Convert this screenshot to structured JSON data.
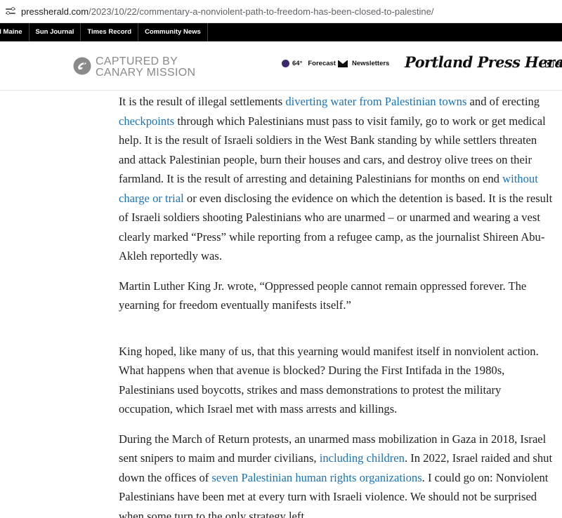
{
  "browser": {
    "url_host": "pressherald.com",
    "url_path": "/2023/10/22/commentary-a-nonviolent-path-to-freedom-has-been-closed-to-palestine/"
  },
  "topnav": {
    "items": [
      "al Maine",
      "Sun Journal",
      "Times Record",
      "Community News"
    ]
  },
  "header": {
    "canary_line1": "CAPTURED BY",
    "canary_line2": "CANARY MISSION",
    "temperature": "64°",
    "forecast_label": "Forecast",
    "newsletters_label": "Newsletters",
    "masthead": "Portland Press Herald",
    "epaper_label": "e",
    "colors": {
      "canary_gray": "#8a8a8a",
      "link_blue": "#1a73b8",
      "moon_purple": "#3b2a6e"
    }
  },
  "article": {
    "p1": {
      "t1": "It is the result of illegal settlements ",
      "l1": "diverting water from Palestinian towns",
      "t2": " and of erecting ",
      "l2": "checkpoints",
      "t3": " through which Palestinians must pass to visit family, go to work or get medical help. It is the result of Israeli soldiers in the West Bank standing by while settlers threaten and attack Palestinian people, burn their houses and cars, and destroy olive trees on their farmland. It is the result of arresting and detaining Palestinians for months on end ",
      "l3": "without charge or trial",
      "t4": " or even disclosing the evidence on which the detention is based. It is the result of Israeli soldiers shooting Palestinians who are unarmed – or unarmed and wearing a vest clearly marked “Press” while reporting from a refugee camp, as the journalist Shireen Abu-Akleh reportedly was."
    },
    "p2": "Martin Luther King Jr. wrote, “Oppressed people cannot remain oppressed forever. The yearning for freedom eventually manifests itself.”",
    "p3": "King hoped, like many of us, that this yearning would manifest itself in nonviolent action. What happens when that avenue is blocked? During the First Intifada in the 1980s, Palestinians used boycotts, strikes and mass demonstrations to protest the military occupation, which Israel met with mass arrests and killings.",
    "p4": {
      "t1": "During the March of Return protests, an unarmed mass mobilization in Gaza in 2018, Israel sent snipers to maim and murder civilians, ",
      "l1": "including children",
      "t2": ". In 2022, Israel raided and shut down the offices of ",
      "l2": "seven Palestinian human rights organizations",
      "t3": ". I could go on: Nonviolent Palestinians have been met at every turn with Israeli violence. We should not be surprised when some turn to the only strategy left."
    }
  }
}
